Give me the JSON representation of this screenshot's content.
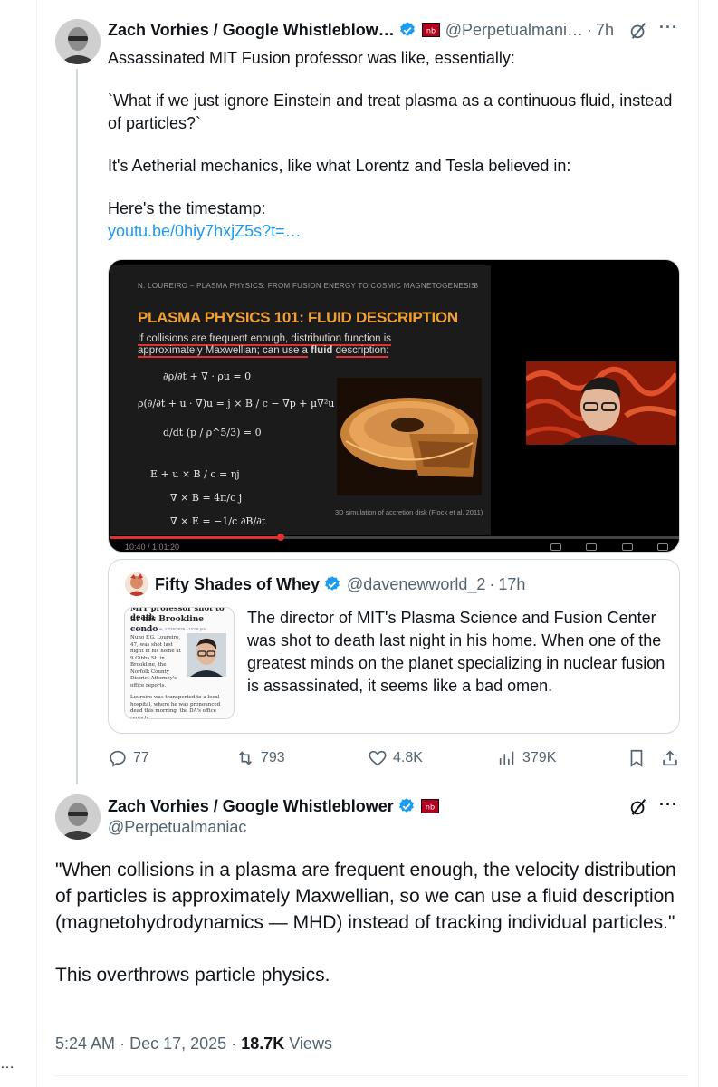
{
  "colors": {
    "accent": "#1d9bf0",
    "text": "#0f1419",
    "secondary": "#536471",
    "border": "#cfd9de",
    "progress": "#e03030"
  },
  "page": {
    "left_dots": "…"
  },
  "tweet1": {
    "name": "Zach Vorhies / Google Whistleblow…",
    "handle": "@Perpetualmani…",
    "separator": "·",
    "time": "7h",
    "more": "···",
    "text_lines": [
      "Assassinated MIT Fusion professor was like, essentially:",
      "`What if we just ignore Einstein and treat plasma as a continuous fluid, instead of particles?`",
      "It's Aetherial mechanics, like what Lorentz and Tesla believed in:",
      "Here's the timestamp:"
    ],
    "link": "youtu.be/0hiy7hxjZ5s?t=…",
    "video": {
      "slide_header": "N. LOUREIRO – PLASMA PHYSICS: FROM FUSION ENERGY TO COSMIC MAGNETOGENESIS",
      "slide_page": "8",
      "slide_title": "PLASMA PHYSICS 101: FLUID DESCRIPTION",
      "slide_sub_1": "If collisions are frequent enough, distribution function is",
      "slide_sub_2": "approximately Maxwellian; can use a",
      "slide_sub_bold": "fluid",
      "slide_sub_3": "description:",
      "equations": [
        "∂ρ/∂t + ∇ · ρu = 0",
        "ρ(∂/∂t + u · ∇)u = j × B / c − ∇p + μ∇²u",
        "d/dt (p / ρ^5/3) = 0",
        "E + u × B / c = ηj",
        "∇ × B = 4π/c j",
        "∇ × E = −1/c ∂B/∂t"
      ],
      "caption": "3D simulation of accretion disk (Flock et al. 2011)",
      "progress": 0.3,
      "time_display": "10:40 / 1:01:20"
    },
    "quote": {
      "name": "Fifty Shades of Whey",
      "handle": "@davenewworld_2",
      "separator": "·",
      "time": "17h",
      "thumb_title": "at his Brookline condo",
      "thumb_title_top": "MIT professor shot to death",
      "thumb_byline": "By adamg on Tue, 12/16/2025 - 12:06 pm",
      "thumb_body_1": "Nuno F.G. Loureiro, 47, was shot last night in his home at 9 Gibbs St. in Brookline, the Norfolk County District Attorney's office reports.",
      "thumb_body_2": "Loureiro was transported to a local hospital, where he was pronounced dead this morning, the DA's office reports.",
      "text": "The director of MIT's Plasma Science and Fusion Center was shot to death last night in his home. When one of the greatest minds on the planet specializing in nuclear fusion is assassinated, it seems like a bad omen."
    },
    "actions": {
      "replies": "77",
      "reposts": "793",
      "likes": "4.8K",
      "views": "379K"
    }
  },
  "tweet2": {
    "name": "Zach Vorhies / Google Whistleblower",
    "handle": "@Perpetualmaniac",
    "more": "···",
    "paragraph1": "\"When collisions in a plasma are frequent enough, the velocity distribution of particles is approximately Maxwellian, so we can use a fluid description (magnetohydrodynamics — MHD) instead of tracking individual particles.\"",
    "paragraph2": "This overthrows particle physics.",
    "time": "5:24 AM",
    "separator": "·",
    "date": "Dec 17, 2025",
    "views_count": "18.7K",
    "views_label": "Views"
  },
  "icons": {
    "verified": "verified-badge-icon",
    "grok": "grok-icon",
    "reply": "reply-icon",
    "repost": "repost-icon",
    "like": "like-icon",
    "views": "views-icon",
    "bookmark": "bookmark-icon",
    "share": "share-icon"
  }
}
